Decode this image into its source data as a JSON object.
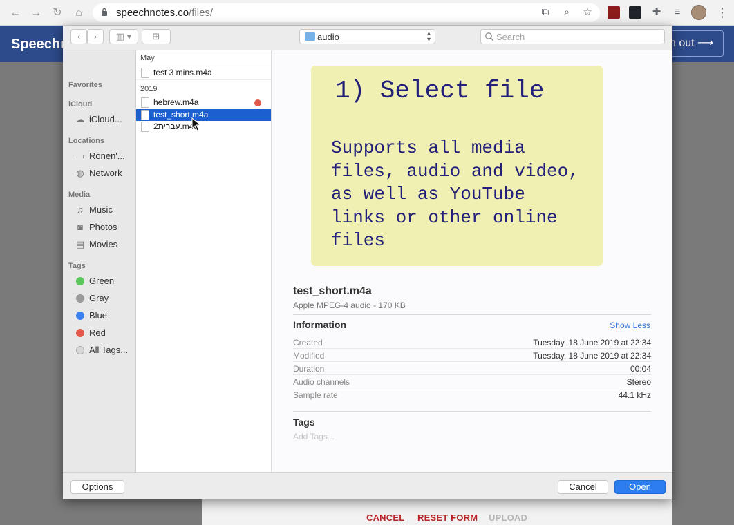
{
  "browser": {
    "url_host": "speechnotes.co",
    "url_path": "/files/"
  },
  "page": {
    "logo": "Speechn",
    "signout_label": "n out",
    "signout_arrow": "⟶",
    "bottom_links": [
      {
        "label": "CANCEL",
        "color": "#b5262a"
      },
      {
        "label": "RESET FORM",
        "color": "#b5262a"
      },
      {
        "label": "UPLOAD",
        "color": "#b5b5b5"
      }
    ]
  },
  "dialog": {
    "location": "audio",
    "search_placeholder": "Search",
    "sidebar": {
      "favorites": "Favorites",
      "icloud": "iCloud",
      "icloud_item": "iCloud...",
      "locations": "Locations",
      "location_items": [
        "Ronen'...",
        "Network"
      ],
      "media": "Media",
      "media_items": [
        "Music",
        "Photos",
        "Movies"
      ],
      "tags": "Tags",
      "tag_items": [
        {
          "label": "Green",
          "color": "#5cc65c"
        },
        {
          "label": "Gray",
          "color": "#9a9a9a"
        },
        {
          "label": "Blue",
          "color": "#3b82f0"
        },
        {
          "label": "Red",
          "color": "#e0594a"
        },
        {
          "label": "All Tags...",
          "color": "#d8d8d8"
        }
      ]
    },
    "files": {
      "groups": [
        {
          "label": "May",
          "files": [
            {
              "name": "test 3 mins.m4a",
              "selected": false,
              "tagged": false
            }
          ]
        },
        {
          "label": "2019",
          "files": [
            {
              "name": "hebrew.m4a",
              "selected": false,
              "tagged": true
            },
            {
              "name": "test_short.m4a",
              "selected": true,
              "tagged": false
            },
            {
              "name": "עברית2.m4a",
              "selected": false,
              "tagged": false
            }
          ]
        }
      ]
    },
    "preview": {
      "note_title": "1) Select file",
      "note_body": "Supports all media files, audio and video, as well as YouTube links or other online files",
      "file_name": "test_short.m4a",
      "file_kind": "Apple MPEG-4 audio - 170 KB",
      "info_heading": "Information",
      "show_less": "Show Less",
      "info": [
        {
          "key": "Created",
          "value": "Tuesday, 18 June 2019 at 22:34"
        },
        {
          "key": "Modified",
          "value": "Tuesday, 18 June 2019 at 22:34"
        },
        {
          "key": "Duration",
          "value": "00:04"
        },
        {
          "key": "Audio channels",
          "value": "Stereo"
        },
        {
          "key": "Sample rate",
          "value": "44.1 kHz"
        }
      ],
      "tags_heading": "Tags",
      "tags_placeholder": "Add Tags..."
    },
    "footer": {
      "options": "Options",
      "cancel": "Cancel",
      "open": "Open"
    }
  }
}
